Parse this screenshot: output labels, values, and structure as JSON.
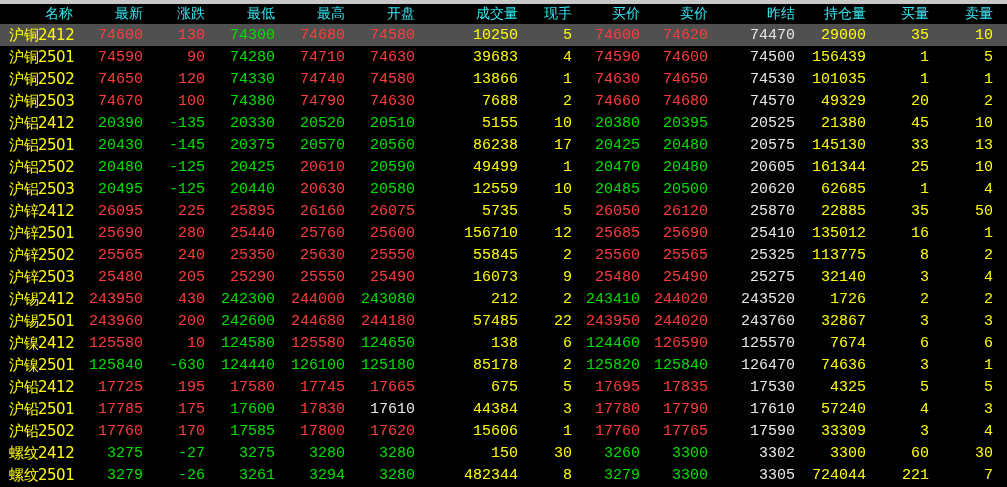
{
  "columns": [
    {
      "label": "名称",
      "kind": "name"
    },
    {
      "label": "最新",
      "kind": "price"
    },
    {
      "label": "涨跌",
      "kind": "price"
    },
    {
      "label": "最低",
      "kind": "price"
    },
    {
      "label": "最高",
      "kind": "price"
    },
    {
      "label": "开盘",
      "kind": "price"
    },
    {
      "label": "成交量",
      "kind": "volume"
    },
    {
      "label": "现手",
      "kind": "volume"
    },
    {
      "label": "买价",
      "kind": "price"
    },
    {
      "label": "卖价",
      "kind": "price"
    },
    {
      "label": "昨结",
      "kind": "reference"
    },
    {
      "label": "持仓量",
      "kind": "volume"
    },
    {
      "label": "买量",
      "kind": "volume"
    },
    {
      "label": "卖量",
      "kind": "volume"
    }
  ],
  "rows": [
    {
      "selected": true,
      "cells": [
        {
          "text": "沪铜2412"
        },
        {
          "text": "74600",
          "color": "#ff3c3c"
        },
        {
          "text": "130",
          "color": "#ff3c3c"
        },
        {
          "text": "74300",
          "color": "#00e000"
        },
        {
          "text": "74680",
          "color": "#ff3c3c"
        },
        {
          "text": "74580",
          "color": "#ff3c3c"
        },
        {
          "text": "10250"
        },
        {
          "text": "5"
        },
        {
          "text": "74600",
          "color": "#ff3c3c"
        },
        {
          "text": "74620",
          "color": "#ff3c3c"
        },
        {
          "text": "74470"
        },
        {
          "text": "29000"
        },
        {
          "text": "35"
        },
        {
          "text": "10"
        }
      ]
    },
    {
      "selected": false,
      "cells": [
        {
          "text": "沪铜2501"
        },
        {
          "text": "74590",
          "color": "#ff3c3c"
        },
        {
          "text": "90",
          "color": "#ff3c3c"
        },
        {
          "text": "74280",
          "color": "#00e000"
        },
        {
          "text": "74710",
          "color": "#ff3c3c"
        },
        {
          "text": "74630",
          "color": "#ff3c3c"
        },
        {
          "text": "39683"
        },
        {
          "text": "4"
        },
        {
          "text": "74590",
          "color": "#ff3c3c"
        },
        {
          "text": "74600",
          "color": "#ff3c3c"
        },
        {
          "text": "74500"
        },
        {
          "text": "156439"
        },
        {
          "text": "1"
        },
        {
          "text": "5"
        }
      ]
    },
    {
      "selected": false,
      "cells": [
        {
          "text": "沪铜2502"
        },
        {
          "text": "74650",
          "color": "#ff3c3c"
        },
        {
          "text": "120",
          "color": "#ff3c3c"
        },
        {
          "text": "74330",
          "color": "#00e000"
        },
        {
          "text": "74740",
          "color": "#ff3c3c"
        },
        {
          "text": "74580",
          "color": "#ff3c3c"
        },
        {
          "text": "13866"
        },
        {
          "text": "1"
        },
        {
          "text": "74630",
          "color": "#ff3c3c"
        },
        {
          "text": "74650",
          "color": "#ff3c3c"
        },
        {
          "text": "74530"
        },
        {
          "text": "101035"
        },
        {
          "text": "1"
        },
        {
          "text": "1"
        }
      ]
    },
    {
      "selected": false,
      "cells": [
        {
          "text": "沪铜2503"
        },
        {
          "text": "74670",
          "color": "#ff3c3c"
        },
        {
          "text": "100",
          "color": "#ff3c3c"
        },
        {
          "text": "74380",
          "color": "#00e000"
        },
        {
          "text": "74790",
          "color": "#ff3c3c"
        },
        {
          "text": "74630",
          "color": "#ff3c3c"
        },
        {
          "text": "7688"
        },
        {
          "text": "2"
        },
        {
          "text": "74660",
          "color": "#ff3c3c"
        },
        {
          "text": "74680",
          "color": "#ff3c3c"
        },
        {
          "text": "74570"
        },
        {
          "text": "49329"
        },
        {
          "text": "20"
        },
        {
          "text": "2"
        }
      ]
    },
    {
      "selected": false,
      "cells": [
        {
          "text": "沪铝2412"
        },
        {
          "text": "20390",
          "color": "#00e000"
        },
        {
          "text": "-135",
          "color": "#00e000"
        },
        {
          "text": "20330",
          "color": "#00e000"
        },
        {
          "text": "20520",
          "color": "#00e000"
        },
        {
          "text": "20510",
          "color": "#00e000"
        },
        {
          "text": "5155"
        },
        {
          "text": "10"
        },
        {
          "text": "20380",
          "color": "#00e000"
        },
        {
          "text": "20395",
          "color": "#00e000"
        },
        {
          "text": "20525"
        },
        {
          "text": "21380"
        },
        {
          "text": "45"
        },
        {
          "text": "10"
        }
      ]
    },
    {
      "selected": false,
      "cells": [
        {
          "text": "沪铝2501"
        },
        {
          "text": "20430",
          "color": "#00e000"
        },
        {
          "text": "-145",
          "color": "#00e000"
        },
        {
          "text": "20375",
          "color": "#00e000"
        },
        {
          "text": "20570",
          "color": "#00e000"
        },
        {
          "text": "20560",
          "color": "#00e000"
        },
        {
          "text": "86238"
        },
        {
          "text": "17"
        },
        {
          "text": "20425",
          "color": "#00e000"
        },
        {
          "text": "20480",
          "color": "#00e000"
        },
        {
          "text": "20575"
        },
        {
          "text": "145130"
        },
        {
          "text": "33"
        },
        {
          "text": "13"
        }
      ]
    },
    {
      "selected": false,
      "cells": [
        {
          "text": "沪铝2502"
        },
        {
          "text": "20480",
          "color": "#00e000"
        },
        {
          "text": "-125",
          "color": "#00e000"
        },
        {
          "text": "20425",
          "color": "#00e000"
        },
        {
          "text": "20610",
          "color": "#ff3c3c"
        },
        {
          "text": "20590",
          "color": "#00e000"
        },
        {
          "text": "49499"
        },
        {
          "text": "1"
        },
        {
          "text": "20470",
          "color": "#00e000"
        },
        {
          "text": "20480",
          "color": "#00e000"
        },
        {
          "text": "20605"
        },
        {
          "text": "161344"
        },
        {
          "text": "25"
        },
        {
          "text": "10"
        }
      ]
    },
    {
      "selected": false,
      "cells": [
        {
          "text": "沪铝2503"
        },
        {
          "text": "20495",
          "color": "#00e000"
        },
        {
          "text": "-125",
          "color": "#00e000"
        },
        {
          "text": "20440",
          "color": "#00e000"
        },
        {
          "text": "20630",
          "color": "#ff3c3c"
        },
        {
          "text": "20580",
          "color": "#00e000"
        },
        {
          "text": "12559"
        },
        {
          "text": "10"
        },
        {
          "text": "20485",
          "color": "#00e000"
        },
        {
          "text": "20500",
          "color": "#00e000"
        },
        {
          "text": "20620"
        },
        {
          "text": "62685"
        },
        {
          "text": "1"
        },
        {
          "text": "4"
        }
      ]
    },
    {
      "selected": false,
      "cells": [
        {
          "text": "沪锌2412"
        },
        {
          "text": "26095",
          "color": "#ff3c3c"
        },
        {
          "text": "225",
          "color": "#ff3c3c"
        },
        {
          "text": "25895",
          "color": "#ff3c3c"
        },
        {
          "text": "26160",
          "color": "#ff3c3c"
        },
        {
          "text": "26075",
          "color": "#ff3c3c"
        },
        {
          "text": "5735"
        },
        {
          "text": "5"
        },
        {
          "text": "26050",
          "color": "#ff3c3c"
        },
        {
          "text": "26120",
          "color": "#ff3c3c"
        },
        {
          "text": "25870"
        },
        {
          "text": "22885"
        },
        {
          "text": "35"
        },
        {
          "text": "50"
        }
      ]
    },
    {
      "selected": false,
      "cells": [
        {
          "text": "沪锌2501"
        },
        {
          "text": "25690",
          "color": "#ff3c3c"
        },
        {
          "text": "280",
          "color": "#ff3c3c"
        },
        {
          "text": "25440",
          "color": "#ff3c3c"
        },
        {
          "text": "25760",
          "color": "#ff3c3c"
        },
        {
          "text": "25600",
          "color": "#ff3c3c"
        },
        {
          "text": "156710"
        },
        {
          "text": "12"
        },
        {
          "text": "25685",
          "color": "#ff3c3c"
        },
        {
          "text": "25690",
          "color": "#ff3c3c"
        },
        {
          "text": "25410"
        },
        {
          "text": "135012"
        },
        {
          "text": "16"
        },
        {
          "text": "1"
        }
      ]
    },
    {
      "selected": false,
      "cells": [
        {
          "text": "沪锌2502"
        },
        {
          "text": "25565",
          "color": "#ff3c3c"
        },
        {
          "text": "240",
          "color": "#ff3c3c"
        },
        {
          "text": "25350",
          "color": "#ff3c3c"
        },
        {
          "text": "25630",
          "color": "#ff3c3c"
        },
        {
          "text": "25550",
          "color": "#ff3c3c"
        },
        {
          "text": "55845"
        },
        {
          "text": "2"
        },
        {
          "text": "25560",
          "color": "#ff3c3c"
        },
        {
          "text": "25565",
          "color": "#ff3c3c"
        },
        {
          "text": "25325"
        },
        {
          "text": "113775"
        },
        {
          "text": "8"
        },
        {
          "text": "2"
        }
      ]
    },
    {
      "selected": false,
      "cells": [
        {
          "text": "沪锌2503"
        },
        {
          "text": "25480",
          "color": "#ff3c3c"
        },
        {
          "text": "205",
          "color": "#ff3c3c"
        },
        {
          "text": "25290",
          "color": "#ff3c3c"
        },
        {
          "text": "25550",
          "color": "#ff3c3c"
        },
        {
          "text": "25490",
          "color": "#ff3c3c"
        },
        {
          "text": "16073"
        },
        {
          "text": "9"
        },
        {
          "text": "25480",
          "color": "#ff3c3c"
        },
        {
          "text": "25490",
          "color": "#ff3c3c"
        },
        {
          "text": "25275"
        },
        {
          "text": "32140"
        },
        {
          "text": "3"
        },
        {
          "text": "4"
        }
      ]
    },
    {
      "selected": false,
      "cells": [
        {
          "text": "沪锡2412"
        },
        {
          "text": "243950",
          "color": "#ff3c3c"
        },
        {
          "text": "430",
          "color": "#ff3c3c"
        },
        {
          "text": "242300",
          "color": "#00e000"
        },
        {
          "text": "244000",
          "color": "#ff3c3c"
        },
        {
          "text": "243080",
          "color": "#00e000"
        },
        {
          "text": "212"
        },
        {
          "text": "2"
        },
        {
          "text": "243410",
          "color": "#00e000"
        },
        {
          "text": "244020",
          "color": "#ff3c3c"
        },
        {
          "text": "243520"
        },
        {
          "text": "1726"
        },
        {
          "text": "2"
        },
        {
          "text": "2"
        }
      ]
    },
    {
      "selected": false,
      "cells": [
        {
          "text": "沪锡2501"
        },
        {
          "text": "243960",
          "color": "#ff3c3c"
        },
        {
          "text": "200",
          "color": "#ff3c3c"
        },
        {
          "text": "242600",
          "color": "#00e000"
        },
        {
          "text": "244680",
          "color": "#ff3c3c"
        },
        {
          "text": "244180",
          "color": "#ff3c3c"
        },
        {
          "text": "57485"
        },
        {
          "text": "22"
        },
        {
          "text": "243950",
          "color": "#ff3c3c"
        },
        {
          "text": "244020",
          "color": "#ff3c3c"
        },
        {
          "text": "243760"
        },
        {
          "text": "32867"
        },
        {
          "text": "3"
        },
        {
          "text": "3"
        }
      ]
    },
    {
      "selected": false,
      "cells": [
        {
          "text": "沪镍2412"
        },
        {
          "text": "125580",
          "color": "#ff3c3c"
        },
        {
          "text": "10",
          "color": "#ff3c3c"
        },
        {
          "text": "124580",
          "color": "#00e000"
        },
        {
          "text": "125580",
          "color": "#ff3c3c"
        },
        {
          "text": "124650",
          "color": "#00e000"
        },
        {
          "text": "138"
        },
        {
          "text": "6"
        },
        {
          "text": "124460",
          "color": "#00e000"
        },
        {
          "text": "126590",
          "color": "#ff3c3c"
        },
        {
          "text": "125570"
        },
        {
          "text": "7674"
        },
        {
          "text": "6"
        },
        {
          "text": "6"
        }
      ]
    },
    {
      "selected": false,
      "cells": [
        {
          "text": "沪镍2501"
        },
        {
          "text": "125840",
          "color": "#00e000"
        },
        {
          "text": "-630",
          "color": "#00e000"
        },
        {
          "text": "124440",
          "color": "#00e000"
        },
        {
          "text": "126100",
          "color": "#00e000"
        },
        {
          "text": "125180",
          "color": "#00e000"
        },
        {
          "text": "85178"
        },
        {
          "text": "2"
        },
        {
          "text": "125820",
          "color": "#00e000"
        },
        {
          "text": "125840",
          "color": "#00e000"
        },
        {
          "text": "126470"
        },
        {
          "text": "74636"
        },
        {
          "text": "3"
        },
        {
          "text": "1"
        }
      ]
    },
    {
      "selected": false,
      "cells": [
        {
          "text": "沪铅2412"
        },
        {
          "text": "17725",
          "color": "#ff3c3c"
        },
        {
          "text": "195",
          "color": "#ff3c3c"
        },
        {
          "text": "17580",
          "color": "#ff3c3c"
        },
        {
          "text": "17745",
          "color": "#ff3c3c"
        },
        {
          "text": "17665",
          "color": "#ff3c3c"
        },
        {
          "text": "675"
        },
        {
          "text": "5"
        },
        {
          "text": "17695",
          "color": "#ff3c3c"
        },
        {
          "text": "17835",
          "color": "#ff3c3c"
        },
        {
          "text": "17530"
        },
        {
          "text": "4325"
        },
        {
          "text": "5"
        },
        {
          "text": "5"
        }
      ]
    },
    {
      "selected": false,
      "cells": [
        {
          "text": "沪铅2501"
        },
        {
          "text": "17785",
          "color": "#ff3c3c"
        },
        {
          "text": "175",
          "color": "#ff3c3c"
        },
        {
          "text": "17600",
          "color": "#00e000"
        },
        {
          "text": "17830",
          "color": "#ff3c3c"
        },
        {
          "text": "17610",
          "color": "#e8e8e8"
        },
        {
          "text": "44384"
        },
        {
          "text": "3"
        },
        {
          "text": "17780",
          "color": "#ff3c3c"
        },
        {
          "text": "17790",
          "color": "#ff3c3c"
        },
        {
          "text": "17610"
        },
        {
          "text": "57240"
        },
        {
          "text": "4"
        },
        {
          "text": "3"
        }
      ]
    },
    {
      "selected": false,
      "cells": [
        {
          "text": "沪铅2502"
        },
        {
          "text": "17760",
          "color": "#ff3c3c"
        },
        {
          "text": "170",
          "color": "#ff3c3c"
        },
        {
          "text": "17585",
          "color": "#00e000"
        },
        {
          "text": "17800",
          "color": "#ff3c3c"
        },
        {
          "text": "17620",
          "color": "#ff3c3c"
        },
        {
          "text": "15606"
        },
        {
          "text": "1"
        },
        {
          "text": "17760",
          "color": "#ff3c3c"
        },
        {
          "text": "17765",
          "color": "#ff3c3c"
        },
        {
          "text": "17590"
        },
        {
          "text": "33309"
        },
        {
          "text": "3"
        },
        {
          "text": "4"
        }
      ]
    },
    {
      "selected": false,
      "cells": [
        {
          "text": "螺纹2412"
        },
        {
          "text": "3275",
          "color": "#00e000"
        },
        {
          "text": "-27",
          "color": "#00e000"
        },
        {
          "text": "3275",
          "color": "#00e000"
        },
        {
          "text": "3280",
          "color": "#00e000"
        },
        {
          "text": "3280",
          "color": "#00e000"
        },
        {
          "text": "150"
        },
        {
          "text": "30"
        },
        {
          "text": "3260",
          "color": "#00e000"
        },
        {
          "text": "3300",
          "color": "#00e000"
        },
        {
          "text": "3302"
        },
        {
          "text": "3300"
        },
        {
          "text": "60"
        },
        {
          "text": "30"
        }
      ]
    },
    {
      "selected": false,
      "cells": [
        {
          "text": "螺纹2501"
        },
        {
          "text": "3279",
          "color": "#00e000"
        },
        {
          "text": "-26",
          "color": "#00e000"
        },
        {
          "text": "3261",
          "color": "#00e000"
        },
        {
          "text": "3294",
          "color": "#00e000"
        },
        {
          "text": "3280",
          "color": "#00e000"
        },
        {
          "text": "482344"
        },
        {
          "text": "8"
        },
        {
          "text": "3279",
          "color": "#00e000"
        },
        {
          "text": "3300",
          "color": "#00e000"
        },
        {
          "text": "3305"
        },
        {
          "text": "724044"
        },
        {
          "text": "221"
        },
        {
          "text": "7"
        }
      ]
    }
  ]
}
